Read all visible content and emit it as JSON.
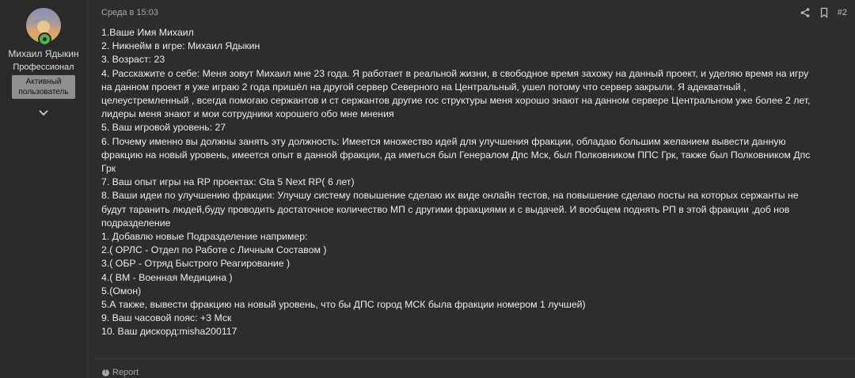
{
  "user": {
    "name": "Михаил Ядыкин",
    "title": "Профессионал",
    "banner_line1": "Активный",
    "banner_line2": "пользователь",
    "avatar_icon": "avatar-image",
    "online_status": "online"
  },
  "post": {
    "date": "Среда в 15:03",
    "number": "#2",
    "share_icon": "share-icon",
    "bookmark_icon": "bookmark-icon",
    "lines": [
      "1.Ваше Имя Михаил",
      "2. Никнейм в игре: Михаил Ядыкин",
      "3. Возраст: 23",
      "4. Расскажите о себе: Меня зовут Михаил мне 23 года. Я работает в реальной жизни, в свободное время захожу на данный проект, и уделяю время на игру",
      "на данном проект я уже играю 2 года пришёл на другой сервер Северного на Центральный, ушел потому что сервер закрыли. Я адекватный ,",
      "целеустремленный , всегда помогаю сержантов и ст сержантов другие гос структуры меня хорошо знают на данном сервере Центральном уже более 2 лет,",
      "лидеры меня знают и мои сотрудники хорошего обо мне мнения",
      "5. Ваш игровой уровень: 27",
      "6. Почему именно вы должны занять эту должность: Имеется множество идей для улучшения фракции, обладаю большим желанием вывести данную",
      "фракцию на новый уровень, имеется опыт в данной фракции, да иметься был Генералом Дпс Мск, был Полковником ППС Грк, также был Полковником Дпс",
      "Грк",
      "7. Ваш опыт игры на RP проектах: Gta 5 Next RP( 6 лет)",
      "8. Ваши идеи по улучшению фракции: Улучшу систему повышение сделаю их виде онлайн тестов, на повышение сделаю посты на которых сержанты не",
      "будут таранить людей,буду проводить достаточное количество МП с другими фракциями и с выдачей. И вообщем поднять РП в этой фракции ,доб нов",
      "подразделение",
      "1. Добавлю новые Подразделение например:",
      "2.( ОРЛС - Отдел по Работе с Личным Составом )",
      "3.( ОБР - Отряд Быстрого Реагирование )",
      "4.( ВМ - Военная Медицина )",
      "5.(Омон)",
      "5.А также, вывести фракцию на новый уровень, что бы ДПС город МСК была фракции номером 1 лучшей)",
      "9. Ваш часовой пояс: +3 Мск",
      "10. Ваш дискорд:misha200117"
    ]
  },
  "footer": {
    "report_label": "Report",
    "report_icon": "report-icon"
  },
  "colors": {
    "background": "#2d2d2e",
    "panel": "#2a2a2b",
    "text": "#ececec",
    "muted": "#a8a8a8",
    "banner": "#8f8f8f",
    "online": "#4db34d"
  }
}
